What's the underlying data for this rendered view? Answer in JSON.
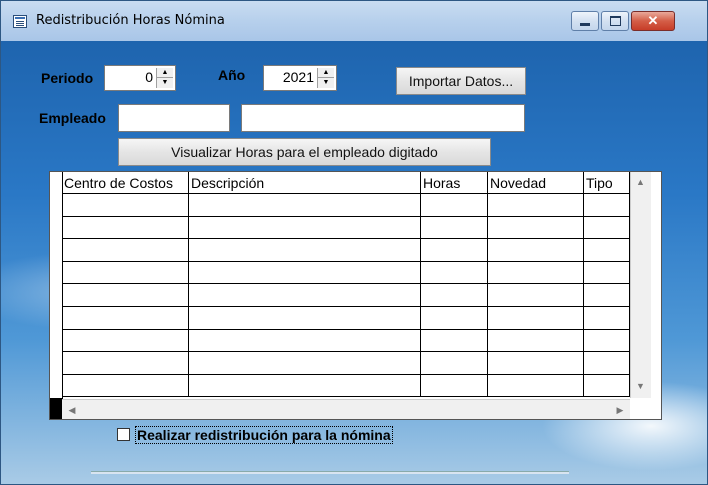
{
  "window": {
    "title": "Redistribución Horas Nómina",
    "minimize_glyph": "",
    "close_glyph": "✕"
  },
  "form": {
    "periodo_label": "Periodo",
    "periodo_value": "0",
    "anio_label": "Año",
    "anio_value": "2021",
    "importar_button": "Importar Datos...",
    "empleado_label": "Empleado",
    "empleado_code": "",
    "empleado_name": "",
    "visualizar_button": "Visualizar Horas para el empleado digitado"
  },
  "grid": {
    "columns": [
      "Centro de Costos",
      "Descripción",
      "Horas",
      "Novedad",
      "Tipo"
    ],
    "rows": [
      [
        "",
        "",
        "",
        "",
        ""
      ],
      [
        "",
        "",
        "",
        "",
        ""
      ],
      [
        "",
        "",
        "",
        "",
        ""
      ],
      [
        "",
        "",
        "",
        "",
        ""
      ],
      [
        "",
        "",
        "",
        "",
        ""
      ],
      [
        "",
        "",
        "",
        "",
        ""
      ],
      [
        "",
        "",
        "",
        "",
        ""
      ],
      [
        "",
        "",
        "",
        "",
        ""
      ],
      [
        "",
        "",
        "",
        "",
        ""
      ]
    ]
  },
  "checkbox": {
    "label": "Realizar redistribución para la nómina",
    "checked": false
  },
  "icons": {
    "app": "table-icon",
    "scroll_up": "▲",
    "scroll_down": "▼",
    "scroll_left": "◀",
    "scroll_right": "▶",
    "spin_up": "▲",
    "spin_down": "▼"
  }
}
